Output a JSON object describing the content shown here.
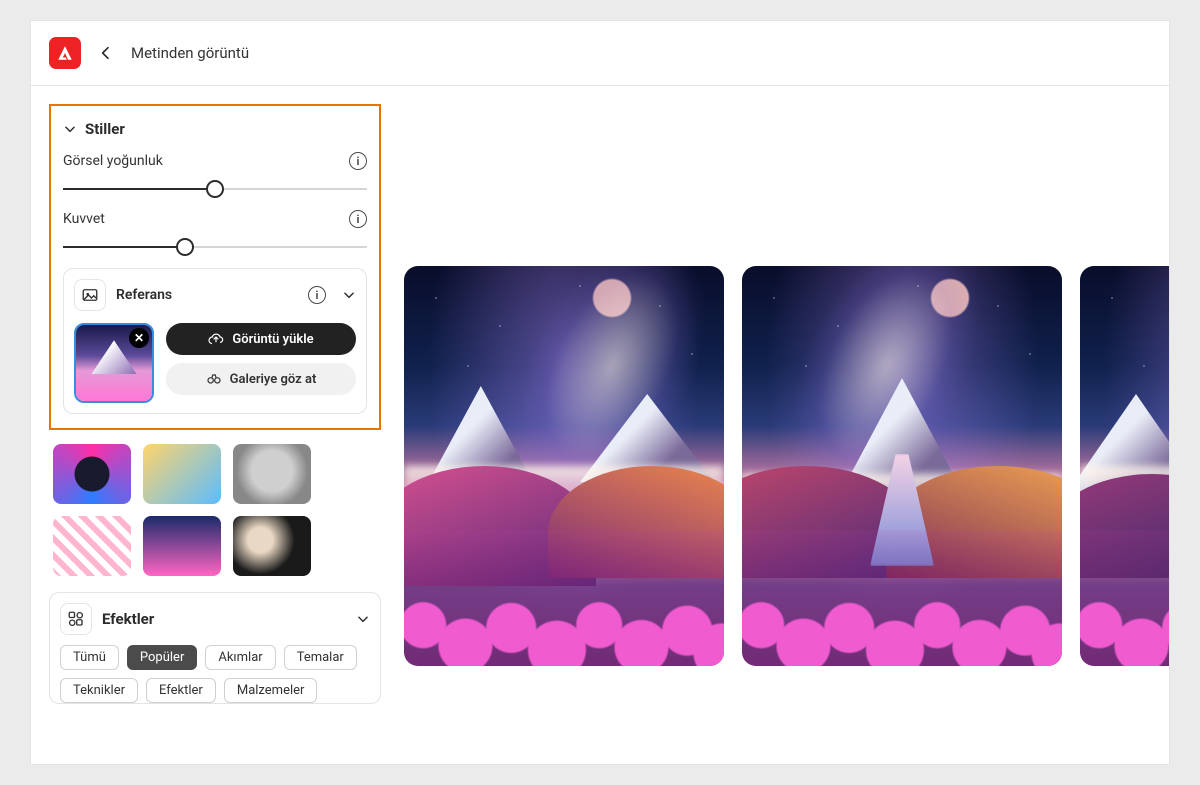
{
  "header": {
    "page_title": "Metinden görüntü"
  },
  "sidebar": {
    "styles": {
      "title": "Stiller",
      "visual_density_label": "Görsel yoğunluk",
      "visual_density_value": 50,
      "strength_label": "Kuvvet",
      "strength_value": 40
    },
    "reference": {
      "title": "Referans",
      "upload_label": "Görüntü yükle",
      "browse_label": "Galeriye göz at",
      "has_thumbnail": true
    },
    "effects": {
      "title": "Efektler",
      "chips": [
        {
          "label": "Tümü",
          "active": false
        },
        {
          "label": "Popüler",
          "active": true
        },
        {
          "label": "Akımlar",
          "active": false
        },
        {
          "label": "Temalar",
          "active": false
        },
        {
          "label": "Teknikler",
          "active": false
        },
        {
          "label": "Efektler",
          "active": false
        },
        {
          "label": "Malzemeler",
          "active": false
        }
      ]
    },
    "style_presets": [
      "neon",
      "thumbs-up",
      "bust",
      "pattern",
      "clouds",
      "photo"
    ]
  },
  "results": {
    "count": 3
  }
}
